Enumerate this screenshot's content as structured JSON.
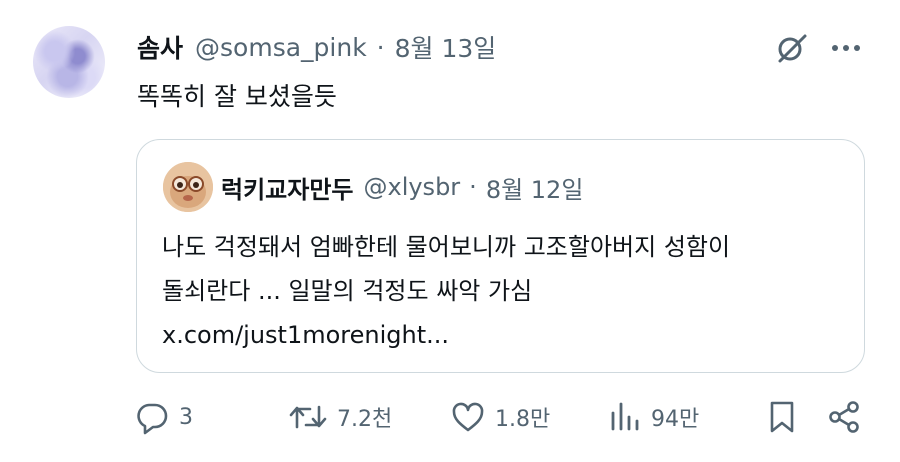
{
  "tweet": {
    "author_name": "솜사",
    "handle": "@somsa_pink",
    "separator": "·",
    "date": "8월 13일",
    "text": "똑똑히 잘 보셨을듯"
  },
  "quoted_tweet": {
    "author_name": "럭키교자만두",
    "handle": "@xlysbr",
    "separator": "·",
    "date": "8월 12일",
    "lines": [
      "나도 걱정돼서 엄빠한테 물어보니까 고조할아버지 성함이",
      "돌쇠란다 ... 일말의 걱정도 싸악 가심",
      "x.com/just1morenight..."
    ]
  },
  "actions": {
    "replies": "3",
    "reposts": "7.2천",
    "likes": "1.8만",
    "views": "94만"
  },
  "icons": {
    "grok": "grok-icon",
    "more": "more-icon",
    "reply": "reply-icon",
    "repost": "repost-icon",
    "like": "like-icon",
    "views": "views-icon",
    "bookmark": "bookmark-icon",
    "share": "share-icon"
  },
  "colors": {
    "text_primary": "#0f1419",
    "text_secondary": "#536471",
    "border": "#cfd9de"
  }
}
